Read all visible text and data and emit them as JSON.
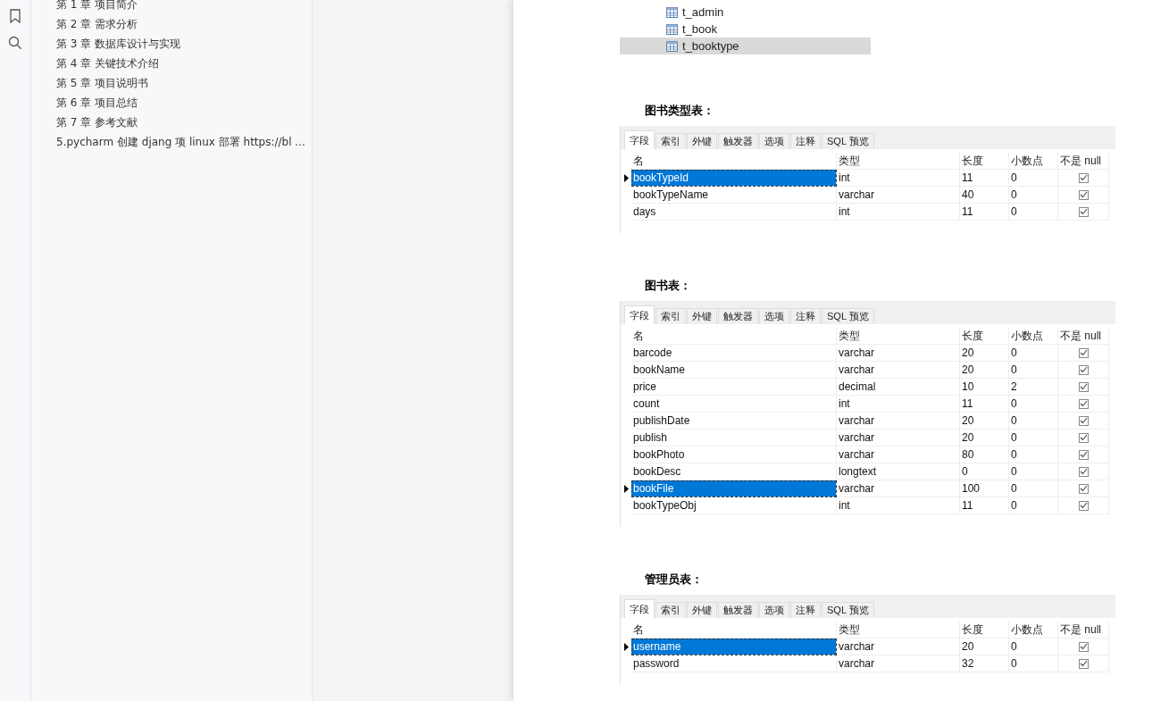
{
  "outline": [
    {
      "label": "第 1 章  项目简介"
    },
    {
      "label": "第 2 章  需求分析"
    },
    {
      "label": "第 3 章  数据库设计与实现"
    },
    {
      "label": "第 4 章  关键技术介绍"
    },
    {
      "label": "第 5 章  项目说明书"
    },
    {
      "label": "第 6 章  项目总结"
    },
    {
      "label": "第 7 章  参考文献"
    },
    {
      "label": "5.pycharm 创建 djang 项 linux 部署 https://bl ..."
    }
  ],
  "tree": [
    {
      "label": "t_admin",
      "selected": false
    },
    {
      "label": "t_book",
      "selected": false
    },
    {
      "label": "t_booktype",
      "selected": true
    }
  ],
  "tables": [
    {
      "title": "图书类型表：",
      "tabs": [
        {
          "label": "字段",
          "selected": true
        },
        {
          "label": "索引",
          "selected": false
        },
        {
          "label": "外键",
          "selected": false
        },
        {
          "label": "触发器",
          "selected": false
        },
        {
          "label": "选项",
          "selected": false
        },
        {
          "label": "注释",
          "selected": false
        },
        {
          "label": "SQL 预览",
          "selected": false
        }
      ],
      "columns": [
        "名",
        "类型",
        "长度",
        "小数点",
        "不是 null"
      ],
      "rows": [
        {
          "name": "bookTypeId",
          "type": "int",
          "length": "11",
          "decimals": "0",
          "not_null": true,
          "selected": true
        },
        {
          "name": "bookTypeName",
          "type": "varchar",
          "length": "40",
          "decimals": "0",
          "not_null": true,
          "selected": false
        },
        {
          "name": "days",
          "type": "int",
          "length": "11",
          "decimals": "0",
          "not_null": true,
          "selected": false
        }
      ]
    },
    {
      "title": "图书表：",
      "tabs": [
        {
          "label": "字段",
          "selected": true
        },
        {
          "label": "索引",
          "selected": false
        },
        {
          "label": "外键",
          "selected": false
        },
        {
          "label": "触发器",
          "selected": false
        },
        {
          "label": "选项",
          "selected": false
        },
        {
          "label": "注释",
          "selected": false
        },
        {
          "label": "SQL 预览",
          "selected": false
        }
      ],
      "columns": [
        "名",
        "类型",
        "长度",
        "小数点",
        "不是 null"
      ],
      "rows": [
        {
          "name": "barcode",
          "type": "varchar",
          "length": "20",
          "decimals": "0",
          "not_null": true,
          "selected": false
        },
        {
          "name": "bookName",
          "type": "varchar",
          "length": "20",
          "decimals": "0",
          "not_null": true,
          "selected": false
        },
        {
          "name": "price",
          "type": "decimal",
          "length": "10",
          "decimals": "2",
          "not_null": true,
          "selected": false
        },
        {
          "name": "count",
          "type": "int",
          "length": "11",
          "decimals": "0",
          "not_null": true,
          "selected": false
        },
        {
          "name": "publishDate",
          "type": "varchar",
          "length": "20",
          "decimals": "0",
          "not_null": true,
          "selected": false
        },
        {
          "name": "publish",
          "type": "varchar",
          "length": "20",
          "decimals": "0",
          "not_null": true,
          "selected": false
        },
        {
          "name": "bookPhoto",
          "type": "varchar",
          "length": "80",
          "decimals": "0",
          "not_null": true,
          "selected": false
        },
        {
          "name": "bookDesc",
          "type": "longtext",
          "length": "0",
          "decimals": "0",
          "not_null": true,
          "selected": false
        },
        {
          "name": "bookFile",
          "type": "varchar",
          "length": "100",
          "decimals": "0",
          "not_null": true,
          "selected": true
        },
        {
          "name": "bookTypeObj",
          "type": "int",
          "length": "11",
          "decimals": "0",
          "not_null": true,
          "selected": false
        }
      ]
    },
    {
      "title": "管理员表：",
      "tabs": [
        {
          "label": "字段",
          "selected": true
        },
        {
          "label": "索引",
          "selected": false
        },
        {
          "label": "外键",
          "selected": false
        },
        {
          "label": "触发器",
          "selected": false
        },
        {
          "label": "选项",
          "selected": false
        },
        {
          "label": "注释",
          "selected": false
        },
        {
          "label": "SQL 预览",
          "selected": false
        }
      ],
      "columns": [
        "名",
        "类型",
        "长度",
        "小数点",
        "不是 null"
      ],
      "rows": [
        {
          "name": "username",
          "type": "varchar",
          "length": "20",
          "decimals": "0",
          "not_null": true,
          "selected": true
        },
        {
          "name": "password",
          "type": "varchar",
          "length": "32",
          "decimals": "0",
          "not_null": true,
          "selected": false
        }
      ]
    }
  ]
}
